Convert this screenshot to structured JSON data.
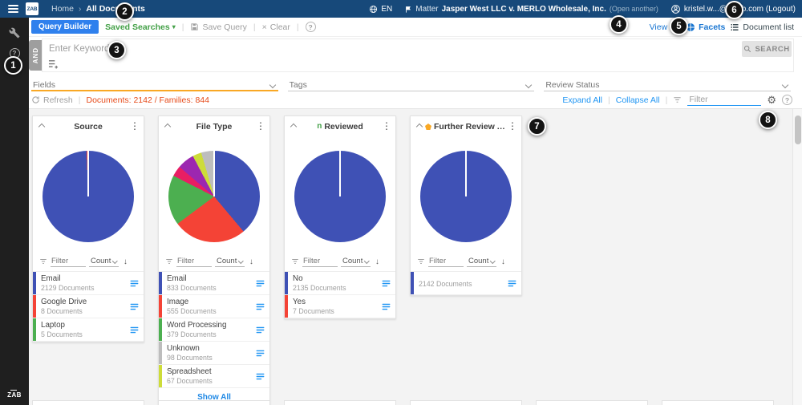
{
  "callouts": [
    "1",
    "2",
    "3",
    "4",
    "5",
    "6",
    "7",
    "8"
  ],
  "topbar": {
    "breadcrumb_home": "Home",
    "breadcrumb_sep": "›",
    "breadcrumb_current": "All Documents",
    "language": "EN",
    "matter_label": "Matter",
    "matter_name": "Jasper West LLC v. MERLO Wholesale, Inc.",
    "matter_open_another": "(Open another)",
    "user_text": "kristel.w...@zylab.com (Logout)"
  },
  "toolbar": {
    "query_builder": "Query Builder",
    "saved_searches": "Saved Searches",
    "save_query": "Save Query",
    "clear": "Clear",
    "view_as_label": "View as:",
    "facets_label": "Facets",
    "document_list_label": "Document list"
  },
  "search": {
    "operator": "AND",
    "keywords_placeholder": "Enter Keywords",
    "search_button": "SEARCH"
  },
  "filter_dropdowns": {
    "fields": "Fields",
    "tags": "Tags",
    "review_status": "Review Status"
  },
  "results_bar": {
    "refresh": "Refresh",
    "doc_summary": "Documents: 2142 / Families: 844",
    "expand_all": "Expand All",
    "collapse_all": "Collapse All",
    "filter_placeholder": "Filter"
  },
  "colors": {
    "topbar_navy": "#17497a",
    "accent_blue": "#2196f3",
    "pie_blue": "#3f51b5",
    "pie_red": "#f44336",
    "pie_green": "#4caf50",
    "summary_orange": "#e64a19",
    "fields_underline_amber": "#f9a825"
  },
  "chart_data": [
    {
      "type": "pie",
      "title": "Source",
      "filter_placeholder": "Filter",
      "sort_label": "Count",
      "pie_slices": [
        {
          "label": "Email",
          "value": 2129,
          "color": "#3f51b5"
        },
        {
          "label": "Google Drive",
          "value": 8,
          "color": "#f44336"
        },
        {
          "label": "Laptop",
          "value": 5,
          "color": "#4caf50"
        }
      ],
      "items": [
        {
          "label": "Email",
          "count_text": "2129 Documents",
          "color": "#3f51b5"
        },
        {
          "label": "Google Drive",
          "count_text": "8 Documents",
          "color": "#f44336"
        },
        {
          "label": "Laptop",
          "count_text": "5 Documents",
          "color": "#4caf50"
        }
      ]
    },
    {
      "type": "pie",
      "title": "File Type",
      "filter_placeholder": "Filter",
      "sort_label": "Count",
      "show_all_label": "Show All",
      "pie_slices": [
        {
          "label": "Email",
          "value": 833,
          "color": "#3f51b5"
        },
        {
          "label": "Image",
          "value": 555,
          "color": "#f44336"
        },
        {
          "label": "Word Processing",
          "value": 379,
          "color": "#4caf50"
        },
        {
          "value": 80,
          "color": "#e91e63"
        },
        {
          "value": 130,
          "color": "#9c27b0"
        },
        {
          "label": "Spreadsheet",
          "value": 67,
          "color": "#cddc39"
        },
        {
          "label": "Unknown",
          "value": 98,
          "color": "#bdbdbd"
        }
      ],
      "items": [
        {
          "label": "Email",
          "count_text": "833 Documents",
          "color": "#3f51b5"
        },
        {
          "label": "Image",
          "count_text": "555 Documents",
          "color": "#f44336"
        },
        {
          "label": "Word Processing",
          "count_text": "379 Documents",
          "color": "#4caf50"
        },
        {
          "label": "Unknown",
          "count_text": "98 Documents",
          "color": "#bdbdbd"
        },
        {
          "label": "Spreadsheet",
          "count_text": "67 Documents",
          "color": "#cddc39"
        }
      ]
    },
    {
      "type": "pie",
      "title": "Reviewed",
      "type_icon": {
        "glyph": "n",
        "color": "#43a047"
      },
      "filter_placeholder": "Filter",
      "sort_label": "Count",
      "pie_slices": [
        {
          "label": "No",
          "value": 2135,
          "color": "#3f51b5"
        },
        {
          "label": "Yes",
          "value": 7,
          "color": "#f44336"
        }
      ],
      "items": [
        {
          "label": "No",
          "count_text": "2135 Documents",
          "color": "#3f51b5"
        },
        {
          "label": "Yes",
          "count_text": "7 Documents",
          "color": "#f44336"
        }
      ]
    },
    {
      "type": "pie",
      "title": "Further Review As...",
      "type_icon": {
        "shape": "tag",
        "color": "#f9a825"
      },
      "filter_placeholder": "Filter",
      "sort_label": "Count",
      "pie_slices": [
        {
          "label": "",
          "value": 2142,
          "color": "#3f51b5"
        }
      ],
      "items": [
        {
          "label": "",
          "count_text": "2142 Documents",
          "color": "#3f51b5"
        }
      ]
    }
  ]
}
